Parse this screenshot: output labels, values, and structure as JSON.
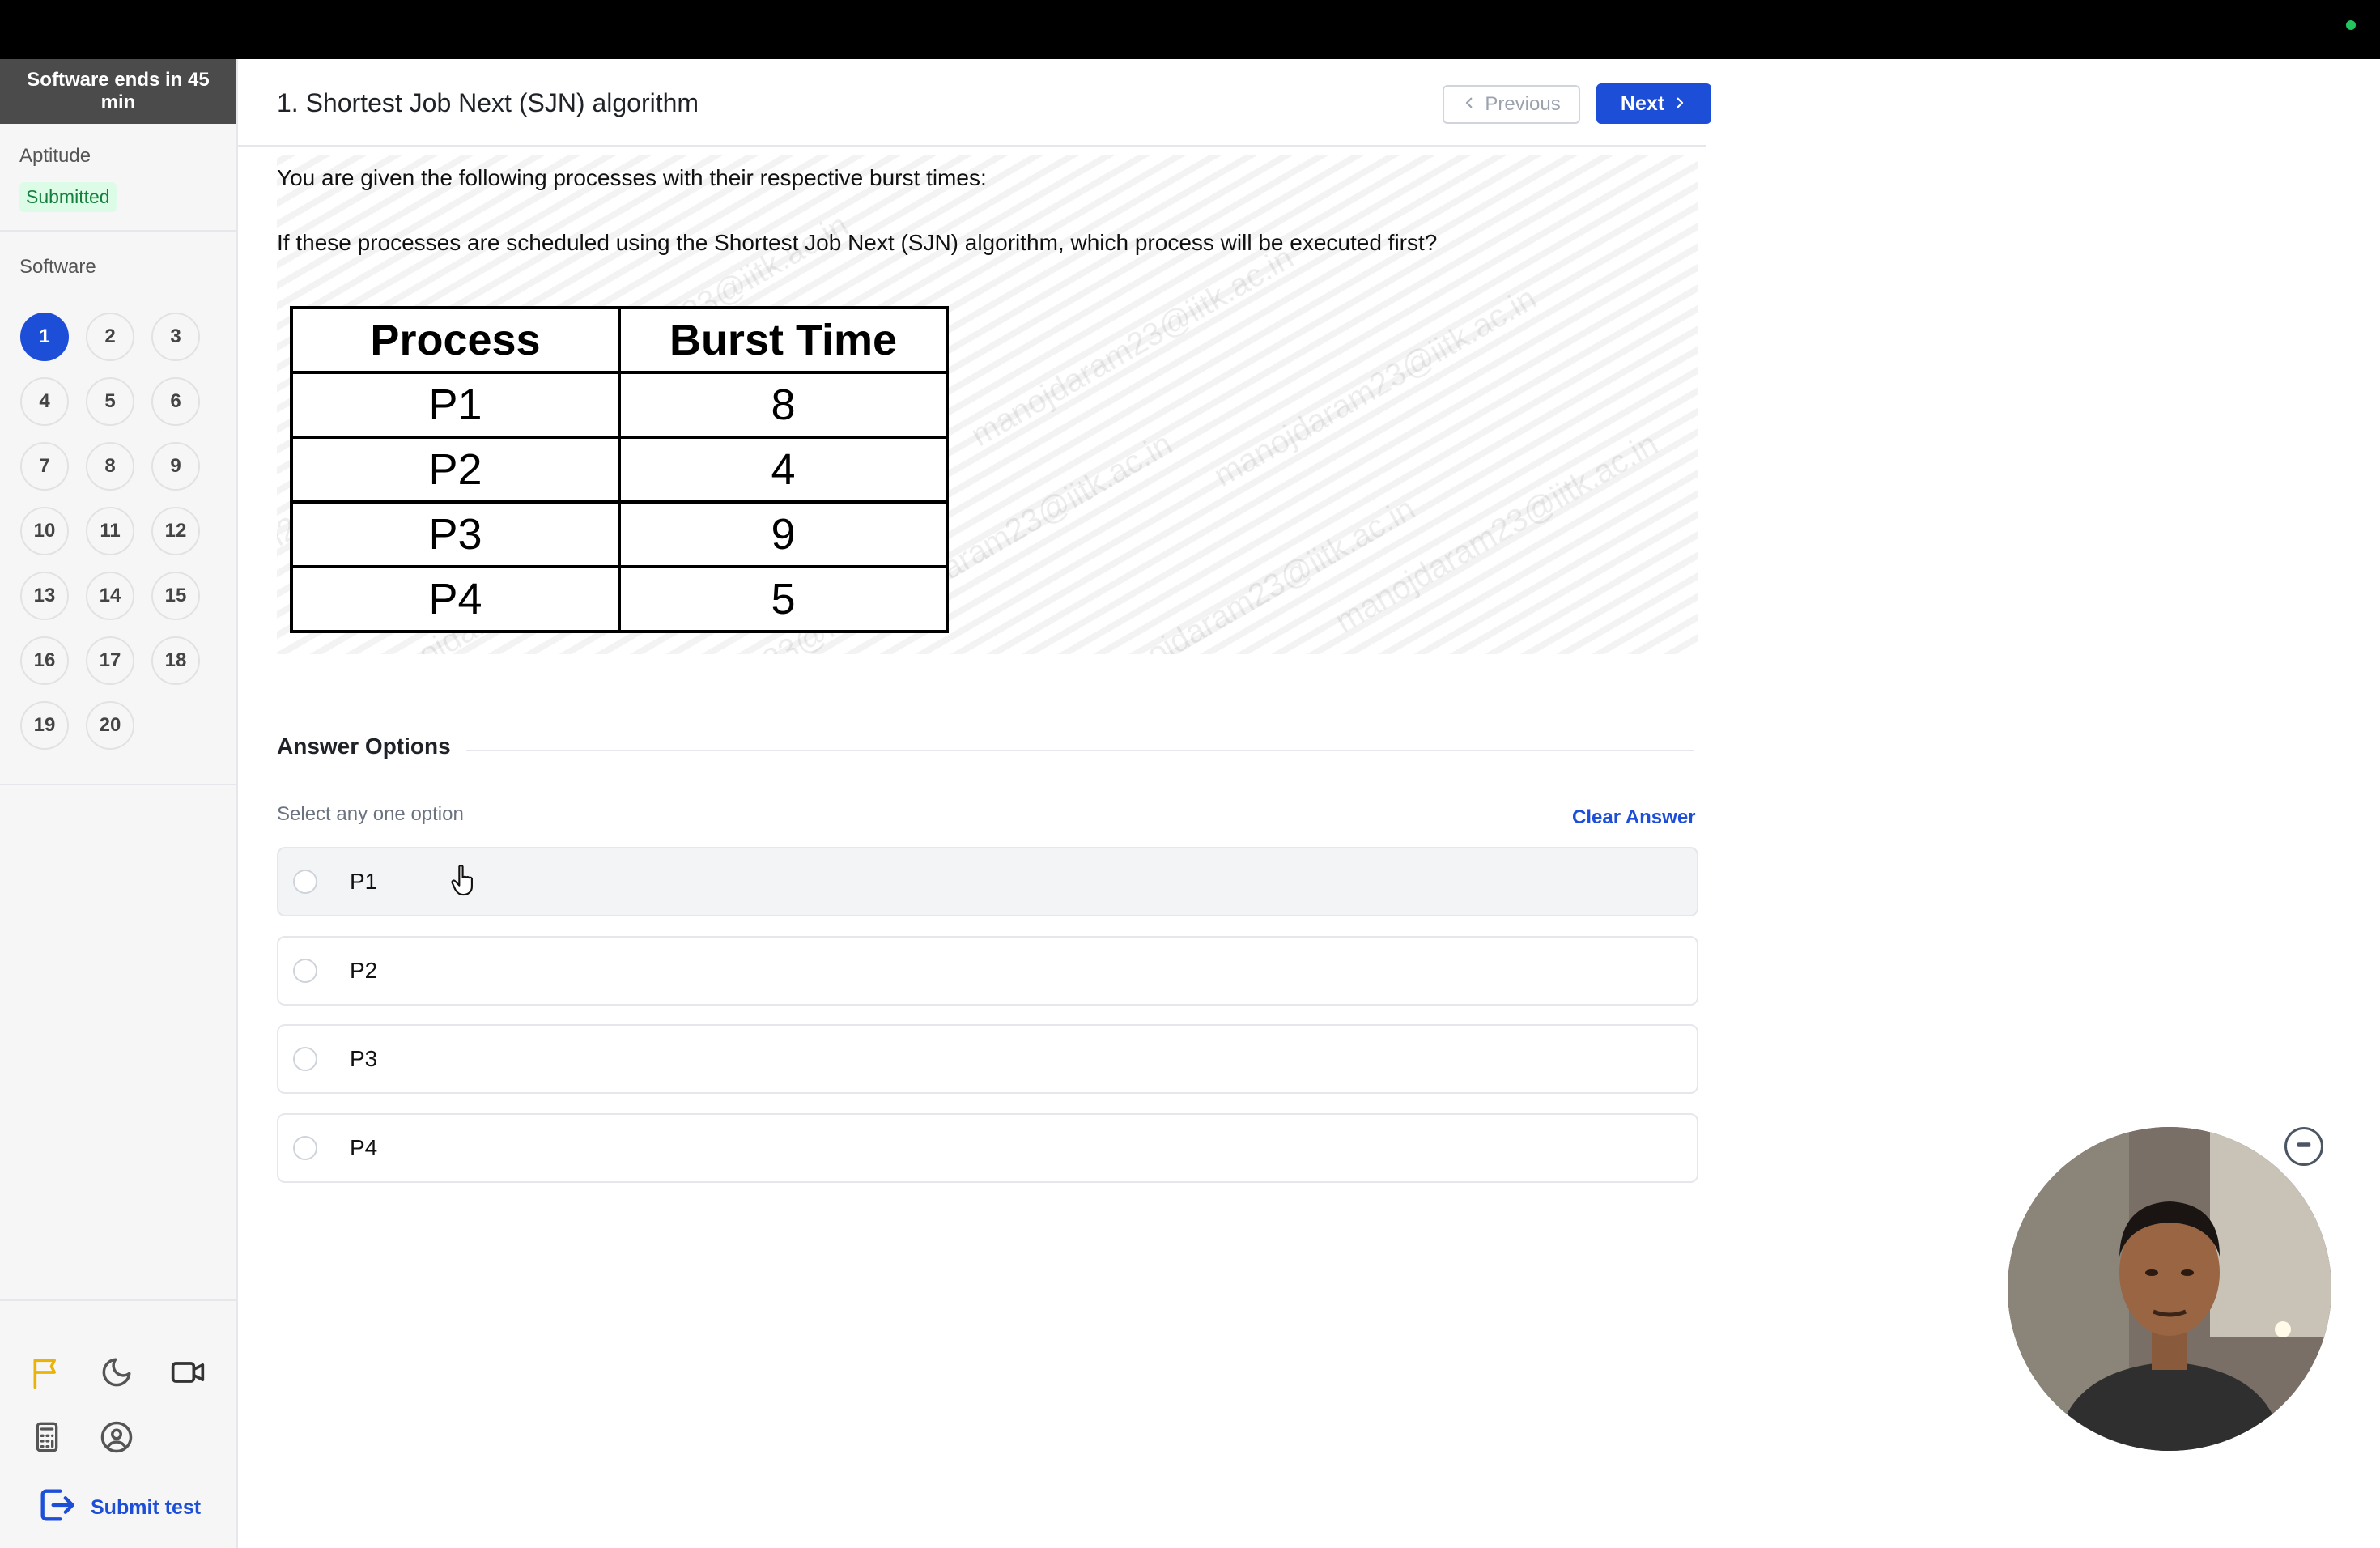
{
  "sidebar": {
    "timer": "Software ends in 45 min",
    "sections": {
      "aptitude": {
        "title": "Aptitude",
        "status": "Submitted"
      },
      "software": {
        "title": "Software"
      }
    },
    "questions": [
      "1",
      "2",
      "3",
      "4",
      "5",
      "6",
      "7",
      "8",
      "9",
      "10",
      "11",
      "12",
      "13",
      "14",
      "15",
      "16",
      "17",
      "18",
      "19",
      "20"
    ],
    "active_question": "1",
    "tools": [
      "flag-icon",
      "moon-icon",
      "video-camera-icon",
      "calculator-icon",
      "user-circle-icon"
    ],
    "submit_label": "Submit test"
  },
  "header": {
    "title": "1. Shortest Job Next (SJN) algorithm",
    "prev_label": "Previous",
    "next_label": "Next"
  },
  "question": {
    "line1": "You are given the following processes with their respective burst times:",
    "line2": "If these processes are scheduled using the Shortest Job Next (SJN) algorithm, which process will be executed first?",
    "table": {
      "headers": [
        "Process",
        "Burst Time"
      ],
      "rows": [
        [
          "P1",
          "8"
        ],
        [
          "P2",
          "4"
        ],
        [
          "P3",
          "9"
        ],
        [
          "P4",
          "5"
        ]
      ]
    },
    "watermark": "manojdaram23@iitk.ac.in"
  },
  "answers": {
    "heading": "Answer Options",
    "hint": "Select any one option",
    "clear_label": "Clear Answer",
    "options": [
      "P1",
      "P2",
      "P3",
      "P4"
    ]
  },
  "colors": {
    "accent": "#1d4ed8",
    "submitted": "#15803d",
    "flag": "#eab308"
  }
}
